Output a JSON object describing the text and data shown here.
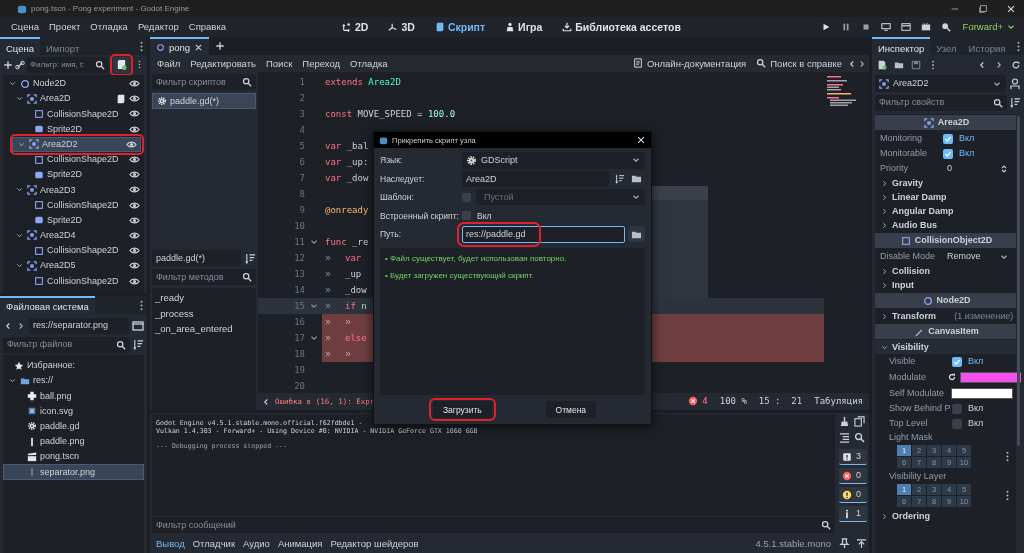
{
  "window": {
    "title": "pong.tscn - Pong experiment - Godot Engine"
  },
  "menu": [
    "Сцена",
    "Проект",
    "Отладка",
    "Редактор",
    "Справка"
  ],
  "workspaces": [
    {
      "label": "2D",
      "selected": false
    },
    {
      "label": "3D",
      "selected": false
    },
    {
      "label": "Скрипт",
      "selected": true
    },
    {
      "label": "Игра",
      "selected": false
    },
    {
      "label": "Библиотека ассетов",
      "selected": false
    }
  ],
  "renderer": "Forward+",
  "scene_dock": {
    "tabs": [
      {
        "label": "Сцена",
        "selected": true
      },
      {
        "label": "Импорт",
        "selected": false
      }
    ],
    "filter": {
      "placeholder": "Фильтр: имя, t:"
    },
    "attach_script_button": {
      "annotated": true
    },
    "tree": [
      {
        "label": "Node2D",
        "kind": "node2d",
        "selected": false,
        "expanded": true,
        "children": [
          {
            "label": "Area2D",
            "kind": "area",
            "selected": false,
            "expanded": true,
            "script": true,
            "children": [
              {
                "label": "CollisionShape2D",
                "kind": "shape",
                "selected": false
              },
              {
                "label": "Sprite2D",
                "kind": "sprite",
                "selected": false
              }
            ]
          },
          {
            "label": "Area2D2",
            "kind": "area",
            "selected": true,
            "expanded": true,
            "annotated": true,
            "children": [
              {
                "label": "CollisionShape2D",
                "kind": "shape",
                "selected": false
              },
              {
                "label": "Sprite2D",
                "kind": "sprite",
                "selected": false
              }
            ]
          },
          {
            "label": "Area2D3",
            "kind": "area",
            "selected": false,
            "expanded": true,
            "children": [
              {
                "label": "CollisionShape2D",
                "kind": "shape",
                "selected": false
              },
              {
                "label": "Sprite2D",
                "kind": "sprite",
                "selected": false
              }
            ]
          },
          {
            "label": "Area2D4",
            "kind": "area",
            "selected": false,
            "expanded": true,
            "children": [
              {
                "label": "CollisionShape2D",
                "kind": "shape",
                "selected": false
              }
            ]
          },
          {
            "label": "Area2D5",
            "kind": "area",
            "selected": false,
            "expanded": true,
            "children": [
              {
                "label": "CollisionShape2D",
                "kind": "shape",
                "selected": false
              }
            ]
          }
        ]
      }
    ]
  },
  "filesystem": {
    "tab": "Файловая система",
    "path": "res://separator.png",
    "filter": {
      "placeholder": "Фильтр файлов"
    },
    "favorites": "Избранное:",
    "tree": [
      {
        "label": "res://",
        "kind": "folder",
        "selected": false,
        "expanded": true,
        "children": [
          {
            "label": "ball.png",
            "kind": "image",
            "selected": false
          },
          {
            "label": "icon.svg",
            "kind": "svg",
            "selected": false
          },
          {
            "label": "paddle.gd",
            "kind": "script",
            "selected": false
          },
          {
            "label": "paddle.png",
            "kind": "bar",
            "selected": false
          },
          {
            "label": "pong.tscn",
            "kind": "scene",
            "selected": false
          },
          {
            "label": "separator.png",
            "kind": "line",
            "selected": true
          }
        ]
      }
    ]
  },
  "script_editor": {
    "tab": "pong",
    "menu": [
      "Файл",
      "Редактировать",
      "Поиск",
      "Переход",
      "Отладка"
    ],
    "help": [
      "Онлайн-документация",
      "Поиск в справке"
    ],
    "script_filter": {
      "placeholder": "Фильтр скриптов"
    },
    "scripts": [
      {
        "label": "paddle.gd(*)",
        "selected": true
      }
    ],
    "current_script": "paddle.gd(*)",
    "method_filter": {
      "placeholder": "Фильтр методов"
    },
    "methods": [
      "_ready",
      "_process",
      "_on_area_entered"
    ],
    "lines": [
      {
        "number": "1",
        "current": false,
        "error": false,
        "fold": false,
        "tokens": [
          {
            "text": "extends",
            "kind": "keyword"
          },
          {
            "text": " Area2D",
            "kind": "type"
          }
        ]
      },
      {
        "number": "2",
        "current": false,
        "error": false,
        "fold": false
      },
      {
        "number": "3",
        "current": false,
        "error": false,
        "fold": false,
        "tokens": [
          {
            "text": "const",
            "kind": "keyword"
          },
          {
            "text": " MOVE_SPEED = ",
            "kind": "plain"
          },
          {
            "text": "100.0",
            "kind": "number"
          }
        ]
      },
      {
        "number": "4",
        "current": false,
        "error": false,
        "fold": false
      },
      {
        "number": "5",
        "current": false,
        "error": false,
        "fold": false,
        "tokens": [
          {
            "text": "var",
            "kind": "keyword"
          },
          {
            "text": " _bal",
            "kind": "plain"
          }
        ]
      },
      {
        "number": "6",
        "current": false,
        "error": false,
        "fold": false,
        "tokens": [
          {
            "text": "var",
            "kind": "keyword"
          },
          {
            "text": " _up:",
            "kind": "plain"
          }
        ]
      },
      {
        "number": "7",
        "current": false,
        "error": false,
        "fold": false,
        "tokens": [
          {
            "text": "var",
            "kind": "keyword"
          },
          {
            "text": " _dow",
            "kind": "plain"
          }
        ]
      },
      {
        "number": "8",
        "current": false,
        "error": false,
        "fold": false
      },
      {
        "number": "9",
        "current": false,
        "error": false,
        "fold": false,
        "tokens": [
          {
            "text": "@onready",
            "kind": "annotation"
          }
        ]
      },
      {
        "number": "10",
        "current": false,
        "error": false,
        "fold": false
      },
      {
        "number": "11",
        "current": false,
        "error": false,
        "fold": true,
        "tokens": [
          {
            "text": "func",
            "kind": "keyword"
          },
          {
            "text": " _re",
            "kind": "plain"
          }
        ]
      },
      {
        "number": "12",
        "current": false,
        "error": false,
        "fold": false,
        "tokens": [
          {
            "text": "»",
            "kind": "tab"
          },
          {
            "text": "var",
            "kind": "keyword"
          }
        ]
      },
      {
        "number": "13",
        "current": false,
        "error": false,
        "fold": false,
        "tokens": [
          {
            "text": "»",
            "kind": "tab"
          },
          {
            "text": "_up",
            "kind": "plain"
          }
        ]
      },
      {
        "number": "14",
        "current": false,
        "error": false,
        "fold": false,
        "tokens": [
          {
            "text": "»",
            "kind": "tab"
          },
          {
            "text": "_dow",
            "kind": "plain"
          }
        ]
      },
      {
        "number": "15",
        "current": true,
        "error": false,
        "fold": true,
        "tokens": [
          {
            "text": "»",
            "kind": "tab"
          },
          {
            "text": "if",
            "kind": "keyword"
          },
          {
            "text": " n",
            "kind": "plain"
          }
        ]
      },
      {
        "number": "16",
        "current": false,
        "error": true,
        "fold": false,
        "tokens": [
          {
            "text": "»",
            "kind": "tab"
          },
          {
            "text": "»",
            "kind": "tab"
          }
        ]
      },
      {
        "number": "17",
        "current": false,
        "error": true,
        "fold": true,
        "tokens": [
          {
            "text": "»",
            "kind": "tab"
          },
          {
            "text": "else",
            "kind": "keyword"
          }
        ]
      },
      {
        "number": "18",
        "current": false,
        "error": true,
        "fold": false,
        "tokens": [
          {
            "text": "»",
            "kind": "tab"
          },
          {
            "text": "»",
            "kind": "tab"
          }
        ]
      },
      {
        "number": "19",
        "current": false,
        "error": false,
        "fold": false
      },
      {
        "number": "20",
        "current": false,
        "error": false,
        "fold": false
      }
    ],
    "status": {
      "error": "Ошибка в (16, 1): Expr",
      "error_count": "4",
      "zoom": "100 %",
      "position": "15 :  21",
      "indent": "Табуляция"
    }
  },
  "dialog": {
    "title": "Прикрепить скрипт узла",
    "language": {
      "label": "Язык:",
      "value": "GDScript"
    },
    "inherits": {
      "label": "Наследует:",
      "value": "Area2D"
    },
    "template": {
      "label": "Шаблон:",
      "value": "Пустой",
      "checked": false,
      "disabled": true
    },
    "builtin": {
      "label": "Встроенный скрипт:",
      "text": "Вкл",
      "checked": false
    },
    "path": {
      "label": "Путь:",
      "value": "res://paddle.gd",
      "annotated": true
    },
    "messages": [
      "• Файл существует, будет использован повторно.",
      "• Будет загружен существующий скрипт."
    ],
    "buttons": [
      {
        "label": "Загрузить",
        "annotated": true
      },
      {
        "label": "Отмена",
        "annotated": false
      }
    ]
  },
  "output": {
    "lines": [
      {
        "text": "Godot Engine v4.5.1.stable.mono.official.f62fdbde1 -",
        "kind": "info"
      },
      {
        "text": "Vulkan 1.4.303 - Forward+ - Using Device #0: NVIDIA - NVIDIA GeForce GTX 1060 6GB",
        "kind": "info"
      },
      {
        "text": "--- Debugging process stopped ---",
        "kind": "muted"
      }
    ],
    "filters": [
      {
        "kind": "message",
        "count": "3"
      },
      {
        "kind": "error",
        "count": "0"
      },
      {
        "kind": "warning",
        "count": "0"
      },
      {
        "kind": "editor",
        "count": "1"
      }
    ],
    "filter": {
      "placeholder": "Фильтр сообщений"
    },
    "tabs": [
      {
        "label": "Вывод",
        "selected": true
      },
      {
        "label": "Отладчик",
        "selected": false
      },
      {
        "label": "Аудио",
        "selected": false
      },
      {
        "label": "Анимация",
        "selected": false
      },
      {
        "label": "Редактор шейдеров",
        "selected": false
      }
    ],
    "version": "4.5.1.stable.mono"
  },
  "inspector": {
    "tabs": [
      {
        "label": "Инспектор",
        "selected": true
      },
      {
        "label": "Узел",
        "selected": false
      },
      {
        "label": "История",
        "selected": false
      }
    ],
    "node": "Area2D2",
    "filter": {
      "placeholder": "Фильтр свойств"
    },
    "rows": [
      {
        "kind": "category",
        "label": "Area2D"
      },
      {
        "kind": "check",
        "label": "Monitoring",
        "text": "Вкл",
        "checked": true
      },
      {
        "kind": "check",
        "label": "Monitorable",
        "text": "Вкл",
        "checked": true
      },
      {
        "kind": "number",
        "label": "Priority",
        "value": "0"
      },
      {
        "kind": "group",
        "label": "Gravity",
        "expanded": false
      },
      {
        "kind": "group",
        "label": "Linear Damp",
        "expanded": false
      },
      {
        "kind": "group",
        "label": "Angular Damp",
        "expanded": false
      },
      {
        "kind": "group",
        "label": "Audio Bus",
        "expanded": false
      },
      {
        "kind": "category",
        "label": "CollisionObject2D"
      },
      {
        "kind": "select",
        "label": "Disable Mode",
        "value": "Remove"
      },
      {
        "kind": "group",
        "label": "Collision",
        "expanded": false
      },
      {
        "kind": "group",
        "label": "Input",
        "expanded": false
      },
      {
        "kind": "category",
        "label": "Node2D"
      },
      {
        "kind": "group",
        "label": "Transform",
        "expanded": false,
        "note": "(1 изменение)"
      },
      {
        "kind": "category",
        "label": "CanvasItem"
      },
      {
        "kind": "group",
        "label": "Visibility",
        "expanded": true,
        "children": [
          {
            "kind": "check",
            "label": "Visible",
            "text": "Вкл",
            "checked": true
          },
          {
            "kind": "color",
            "label": "Modulate",
            "color": "#f64ff0",
            "revert": true
          },
          {
            "kind": "color",
            "label": "Self Modulate",
            "color": "#ffffff",
            "revert": false
          },
          {
            "kind": "check",
            "label": "Show Behind P",
            "text": "Вкл",
            "checked": false
          },
          {
            "kind": "check",
            "label": "Top Level",
            "text": "Вкл",
            "checked": false
          },
          {
            "kind": "layers",
            "label": "Light Mask",
            "cells": [
              {
                "label": "1",
                "on": true
              },
              {
                "label": "2",
                "on": false
              },
              {
                "label": "3",
                "on": false
              },
              {
                "label": "4",
                "on": false
              },
              {
                "label": "5",
                "on": false
              },
              {
                "label": "6",
                "on": false
              },
              {
                "label": "7",
                "on": false
              },
              {
                "label": "8",
                "on": false
              },
              {
                "label": "9",
                "on": false
              },
              {
                "label": "10",
                "on": false
              }
            ]
          },
          {
            "kind": "layers",
            "label": "Visibility Layer",
            "cells": [
              {
                "label": "1",
                "on": true
              },
              {
                "label": "2",
                "on": false
              },
              {
                "label": "3",
                "on": false
              },
              {
                "label": "4",
                "on": false
              },
              {
                "label": "5",
                "on": false
              },
              {
                "label": "6",
                "on": false
              },
              {
                "label": "7",
                "on": false
              },
              {
                "label": "8",
                "on": false
              },
              {
                "label": "9",
                "on": false
              },
              {
                "label": "10",
                "on": false
              }
            ]
          }
        ]
      },
      {
        "kind": "group",
        "label": "Ordering",
        "expanded": false
      }
    ]
  }
}
